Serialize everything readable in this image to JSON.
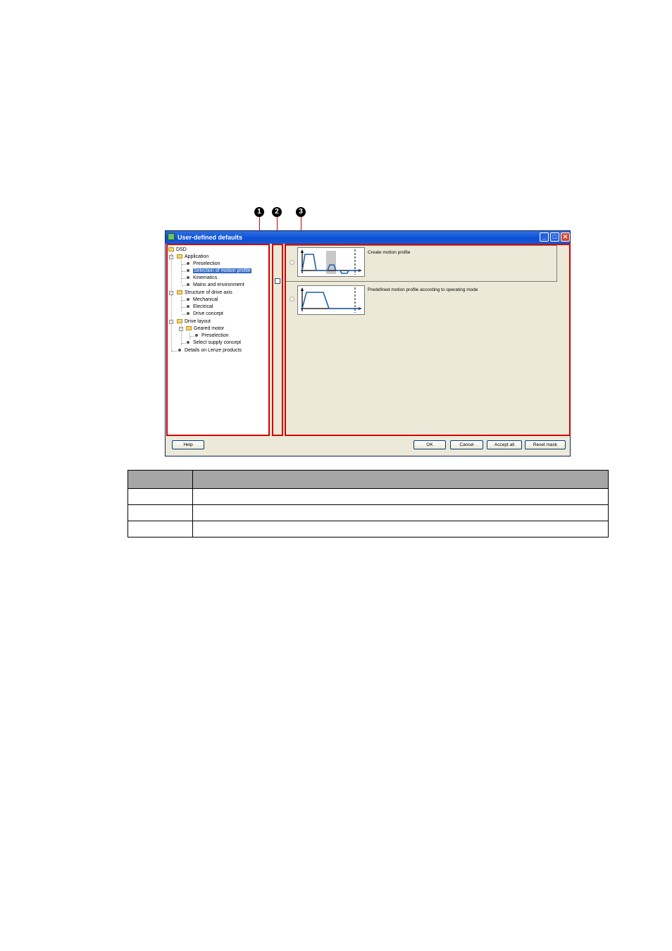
{
  "window": {
    "title": "User-defined defaults",
    "minimize_glyph": "_",
    "maximize_glyph": "□",
    "close_glyph": "✕"
  },
  "callouts": [
    "1",
    "2",
    "3"
  ],
  "tree": {
    "root": "DSD",
    "application": "Application",
    "preselection": "Preselection",
    "selection_motion_profile": "Selection of motion profile",
    "kinematics": "Kinematics",
    "mains": "Mains and environment",
    "structure": "Structure of drive axis",
    "mechanical": "Mechanical",
    "electrical": "Electrical",
    "drive_concept": "Drive concept",
    "drive_layout": "Drive layout",
    "geared_motor": "Geared motor",
    "geared_preselection": "Preselection",
    "supply_concept": "Select supply concept",
    "details": "Details on Lenze products"
  },
  "options": {
    "create": "Create motion profile",
    "predefined": "Predefined motion profile according to operating mode"
  },
  "buttons": {
    "help": "Help",
    "ok": "OK",
    "cancel": "Cancel",
    "accept_all": "Accept all",
    "reset_mask": "Reset mask"
  },
  "colors": {
    "highlight": "#d10000",
    "titlebar": "#0a4fd4",
    "profile_line": "#1f5fa8"
  }
}
